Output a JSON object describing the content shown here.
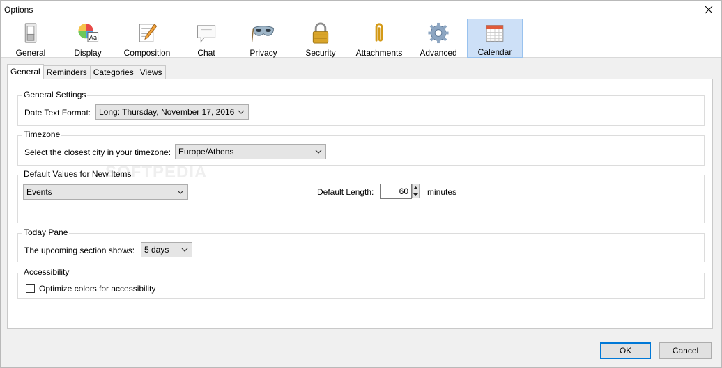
{
  "window": {
    "title": "Options"
  },
  "toolbar": {
    "items": [
      {
        "label": "General",
        "icon": "switch-icon"
      },
      {
        "label": "Display",
        "icon": "display-icon"
      },
      {
        "label": "Composition",
        "icon": "composition-icon"
      },
      {
        "label": "Chat",
        "icon": "chat-icon"
      },
      {
        "label": "Privacy",
        "icon": "mask-icon"
      },
      {
        "label": "Security",
        "icon": "padlock-icon"
      },
      {
        "label": "Attachments",
        "icon": "paperclip-icon"
      },
      {
        "label": "Advanced",
        "icon": "gear-icon"
      },
      {
        "label": "Calendar",
        "icon": "calendar-icon"
      }
    ],
    "selected": "Calendar"
  },
  "subtabs": {
    "items": [
      "General",
      "Reminders",
      "Categories",
      "Views"
    ],
    "active": "General"
  },
  "general_settings": {
    "title": "General Settings",
    "date_format_label": "Date Text Format:",
    "date_format_value": "Long: Thursday, November 17, 2016"
  },
  "timezone": {
    "title": "Timezone",
    "city_label": "Select the closest city in your timezone:",
    "city_value": "Europe/Athens"
  },
  "defaults": {
    "title": "Default Values for New Items",
    "type_value": "Events",
    "length_label": "Default Length:",
    "length_value": "60",
    "length_unit": "minutes"
  },
  "today_pane": {
    "title": "Today Pane",
    "upcoming_label": "The upcoming section shows:",
    "upcoming_value": "5 days"
  },
  "accessibility": {
    "title": "Accessibility",
    "optimize_label": "Optimize colors for accessibility",
    "optimize_checked": false
  },
  "buttons": {
    "ok": "OK",
    "cancel": "Cancel"
  },
  "watermark": "SOFTPEDIA",
  "colors": {
    "selected_bg": "#cde0f7",
    "selected_border": "#99c2ee",
    "default_button_border": "#0078d7"
  }
}
